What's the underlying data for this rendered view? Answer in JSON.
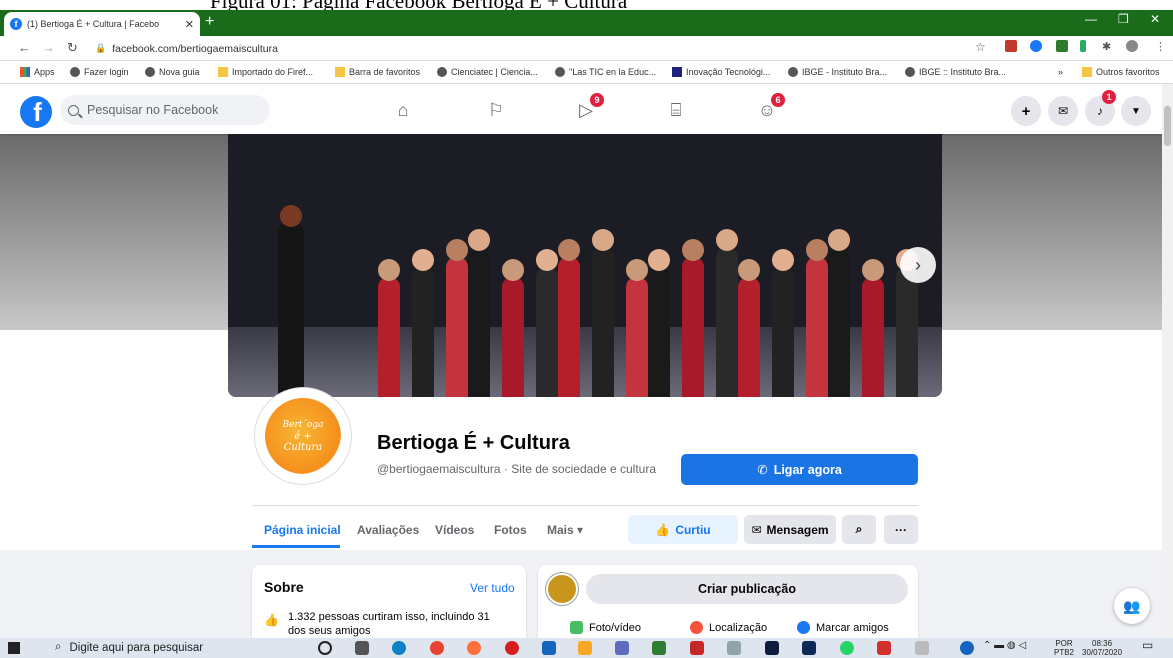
{
  "caption": "Figura 01: Página Facebook Bertioga É + Cultura",
  "browser": {
    "tab_title": "(1) Bertioga É + Cultura | Facebo",
    "tab_close": "✕",
    "new_tab": "+",
    "url": "facebook.com/bertiogaemaiscultura",
    "window_controls": [
      "—",
      "❐",
      "✕"
    ]
  },
  "bookmarks": {
    "items": [
      {
        "label": "Apps",
        "icon": "apps-icon"
      },
      {
        "label": "Fazer login",
        "icon": "globe-icon"
      },
      {
        "label": "Nova guia",
        "icon": "globe-icon"
      },
      {
        "label": "Importado do Firef...",
        "icon": "folder-icon"
      },
      {
        "label": "Barra de favoritos",
        "icon": "folder-icon"
      },
      {
        "label": "Cienciatec | Ciencia...",
        "icon": "globe-icon"
      },
      {
        "label": "\"Las TIC en la Educ...",
        "icon": "globe-icon"
      },
      {
        "label": "Inovação Tecnológi...",
        "icon": "it-icon"
      },
      {
        "label": "IBGE - Instituto Bra...",
        "icon": "globe-icon"
      },
      {
        "label": "IBGE :: Instituto Bra...",
        "icon": "globe-icon"
      }
    ],
    "overflow": "»",
    "other": "Outros favoritos"
  },
  "fb_header": {
    "logo": "f",
    "search_placeholder": "Pesquisar no Facebook",
    "watch_badge": "9",
    "groups_badge": "6",
    "notifications_badge": "1"
  },
  "page": {
    "name": "Bertioga É + Cultura",
    "subtitle": "@bertiogaemaiscultura · Site de sociedade e cultura",
    "avatar_text": [
      "Bert´oga",
      "é +",
      "Cultura"
    ],
    "call_button": "Ligar agora",
    "tabs": [
      "Página inicial",
      "Avaliações",
      "Vídeos",
      "Fotos",
      "Mais ▾"
    ],
    "liked_button": "Curtiu",
    "message_button": "Mensagem",
    "more_button": "···"
  },
  "about": {
    "title": "Sobre",
    "see_all": "Ver tudo",
    "likes_text": "1.332 pessoas curtiram isso, incluindo 31 dos seus amigos"
  },
  "composer": {
    "create_post": "Criar publicação",
    "options": [
      "Foto/vídeo",
      "Localização",
      "Marcar amigos"
    ]
  },
  "taskbar": {
    "search_placeholder": "Digite aqui para pesquisar",
    "lang": "POR",
    "lang2": "PTB2",
    "time": "08:36",
    "date": "30/07/2020"
  },
  "colors": {
    "fb_blue": "#1877f2",
    "chrome_green": "#1a6c1a",
    "badge_red": "#e41e3f"
  }
}
